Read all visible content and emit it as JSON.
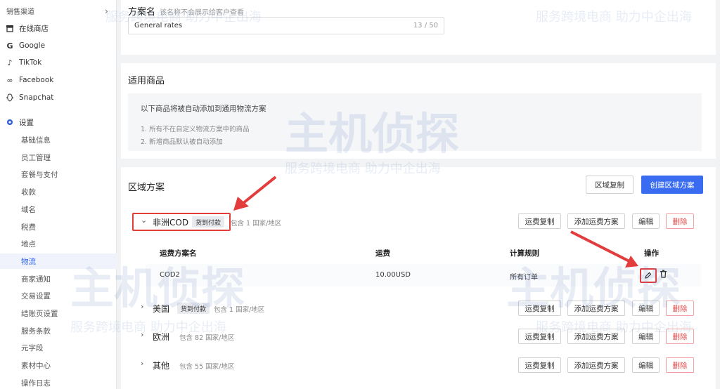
{
  "sidebar": {
    "section_header": "销售渠道",
    "channels": [
      {
        "label": "在线商店",
        "icon": "store-icon"
      },
      {
        "label": "Google",
        "icon": "google-icon"
      },
      {
        "label": "TikTok",
        "icon": "tiktok-icon"
      },
      {
        "label": "Facebook",
        "icon": "facebook-icon"
      },
      {
        "label": "Snapchat",
        "icon": "snapchat-icon"
      }
    ],
    "settings_label": "设置",
    "settings_items": [
      "基础信息",
      "员工管理",
      "套餐与支付",
      "收款",
      "域名",
      "税费",
      "地点",
      "物流",
      "商家通知",
      "交易设置",
      "结账页设置",
      "服务条款",
      "元字段",
      "素材中心",
      "操作日志"
    ],
    "active_item": "物流"
  },
  "plan_name": {
    "label": "方案名",
    "hint": "该名称不会展示给客户查看",
    "value": "General rates",
    "counter": "13 / 50"
  },
  "products": {
    "title": "适用商品",
    "line1": "以下商品将被自动添加到通用物流方案",
    "line2": "1. 所有不在自定义物流方案中的商品",
    "line3": "2. 新增商品默认被自动添加"
  },
  "zones": {
    "title": "区域方案",
    "copy_zone_btn": "区域复制",
    "create_zone_btn": "创建区域方案",
    "row_buttons": {
      "copy": "运费复制",
      "add": "添加运费方案",
      "edit": "编辑",
      "delete": "删除"
    },
    "table_headers": {
      "name": "运费方案名",
      "fee": "运费",
      "rule": "计算规则",
      "ops": "操作"
    },
    "list": [
      {
        "name": "非洲COD",
        "tag": "货到付款",
        "count": "包含 1 国家/地区",
        "expanded": true,
        "rates": [
          {
            "name": "COD2",
            "fee": "10.00USD",
            "rule": "所有订单"
          }
        ]
      },
      {
        "name": "美国",
        "tag": "货到付款",
        "count": "包含 1 国家/地区",
        "expanded": false
      },
      {
        "name": "欧洲",
        "tag": "",
        "count": "包含 82 国家/地区",
        "expanded": false
      },
      {
        "name": "其他",
        "tag": "",
        "count": "包含 55 国家/地区",
        "expanded": false
      }
    ]
  },
  "watermark": {
    "brand": "主机侦探",
    "slogan": "服务跨境电商  助力中企出海"
  }
}
